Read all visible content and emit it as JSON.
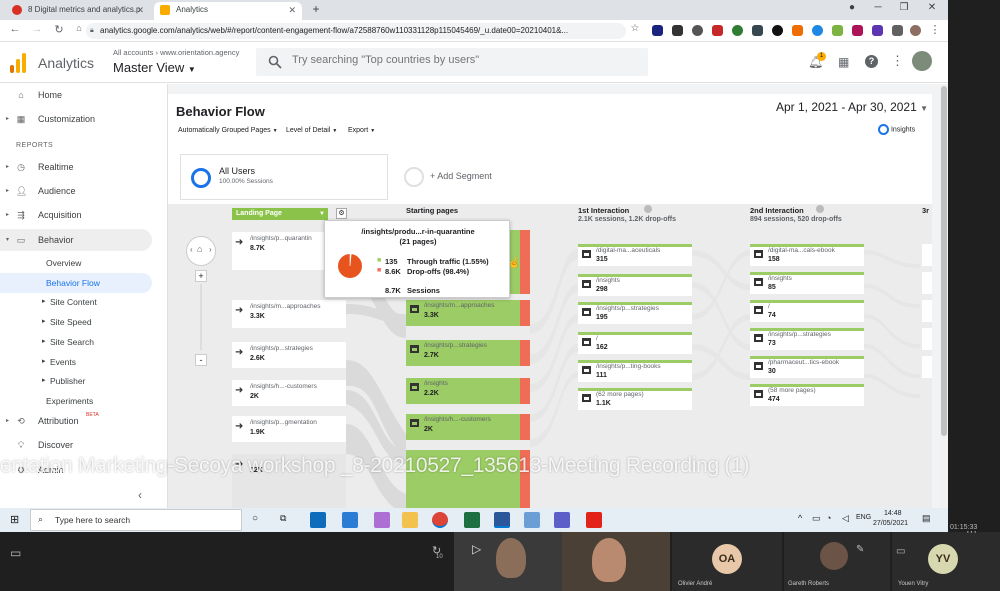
{
  "browser": {
    "tabs": [
      {
        "title": "8 Digital metrics and analytics.p"
      },
      {
        "title": "Analytics"
      }
    ],
    "new_tab": "+",
    "url": "analytics.google.com/analytics/web/#/report/content-engagement-flow/a72588760w110331128p115045469/_u.date00=20210401&...",
    "win_min": "─",
    "win_max": "❐",
    "win_close": "✕"
  },
  "ga": {
    "app_name": "Analytics",
    "breadcrumb": "All accounts › www.orientation.agency",
    "view": "Master View",
    "search_placeholder": "Try searching \"Top countries by users\"",
    "notification_count": "1"
  },
  "sidebar": {
    "items": [
      {
        "label": "Home",
        "icon": "home-icon"
      },
      {
        "label": "Customization",
        "icon": "grid-icon"
      }
    ],
    "reports_label": "REPORTS",
    "reports": [
      {
        "label": "Realtime"
      },
      {
        "label": "Audience"
      },
      {
        "label": "Acquisition"
      },
      {
        "label": "Behavior"
      }
    ],
    "behavior_sub": [
      {
        "label": "Overview"
      },
      {
        "label": "Behavior Flow"
      },
      {
        "label": "Site Content"
      },
      {
        "label": "Site Speed"
      },
      {
        "label": "Site Search"
      },
      {
        "label": "Events"
      },
      {
        "label": "Publisher"
      },
      {
        "label": "Experiments"
      }
    ],
    "attribution": "Attribution",
    "beta": "BETA",
    "discover": "Discover",
    "admin": "Admin",
    "collapse": "‹"
  },
  "report": {
    "title": "Behavior Flow",
    "date_range": "Apr 1, 2021 - Apr 30, 2021",
    "toolbar": [
      "Automatically Grouped Pages",
      "Level of Detail",
      "Export"
    ],
    "insights": "Insights",
    "segment_name": "All Users",
    "segment_pct": "100.00% Sessions",
    "add_segment": "+ Add Segment"
  },
  "flow": {
    "landing_select": "Landing Page",
    "col_starting": "Starting pages",
    "col1": "1st Interaction",
    "col1_sub": "2.1K sessions, 1.2K drop-offs",
    "col2": "2nd Interaction",
    "col2_sub": "894 sessions, 520 drop-offs",
    "col3": "3r",
    "landing": [
      {
        "t": "/insights/p...quarantin",
        "v": "8.7K"
      },
      {
        "t": "/insights/m...approaches",
        "v": "3.3K"
      },
      {
        "t": "/insights/p...strategies",
        "v": "2.6K"
      },
      {
        "t": "/insights/h...-customers",
        "v": "2K"
      },
      {
        "t": "/insights/p...gmentation",
        "v": "1.9K"
      },
      {
        "t": "",
        "v": "12K"
      }
    ],
    "starting": [
      {
        "t": "/insights/m...approaches",
        "v": "3.3K"
      },
      {
        "t": "/insights/p...strategies",
        "v": "2.7K"
      },
      {
        "t": "/insights",
        "v": "2.2K"
      },
      {
        "t": "/insights/h...-customers",
        "v": "2K"
      }
    ],
    "first": [
      {
        "t": "/digital-ma...aceuticals",
        "v": "315"
      },
      {
        "t": "/insights",
        "v": "298"
      },
      {
        "t": "/insights/p...strategies",
        "v": "195"
      },
      {
        "t": "/",
        "v": "162"
      },
      {
        "t": "/insights/p...ting-books",
        "v": "111"
      },
      {
        "t": "(62 more pages)",
        "v": "1.1K"
      }
    ],
    "second": [
      {
        "t": "/digital-ma...cals-ebook",
        "v": "158"
      },
      {
        "t": "/insights",
        "v": "85"
      },
      {
        "t": "/",
        "v": "74"
      },
      {
        "t": "/insights/p...strategies",
        "v": "73"
      },
      {
        "t": "/pharmaceut...tics-ebook",
        "v": "30"
      },
      {
        "t": "(58 more pages)",
        "v": "474"
      }
    ],
    "tooltip": {
      "title": "/insights/produ...r-in-quarantine",
      "subtitle": "(21 pages)",
      "through_value": "135",
      "through_label": "Through traffic (1.55%)",
      "drop_value": "8.6K",
      "drop_label": "Drop-offs (98.4%)",
      "sessions_value": "8.7K",
      "sessions_label": "Sessions",
      "through_fraction": 0.0155
    },
    "zoom_plus": "+",
    "zoom_minus": "-"
  },
  "overlay_text": "entation Marketing-Secoya workshop _8-20210527_135613-Meeting Recording (1)",
  "taskbar": {
    "search_placeholder": "Type here to search",
    "time": "14:48",
    "date": "27/05/2021"
  },
  "meeting": {
    "timer": "01:15:33",
    "participants": [
      {
        "name": "Olivier André",
        "initials": "OA"
      },
      {
        "name": "Gareth Roberts"
      },
      {
        "name": "Youen Vitry",
        "initials": "YV"
      }
    ],
    "more": "···",
    "reaction_count": "10"
  },
  "colors": {
    "ga_orange": "#f9ab00",
    "green_flow": "#9ccc65",
    "dropoff": "#ef6c57",
    "pie": "#e8541e",
    "link_blue": "#1a73e8"
  }
}
